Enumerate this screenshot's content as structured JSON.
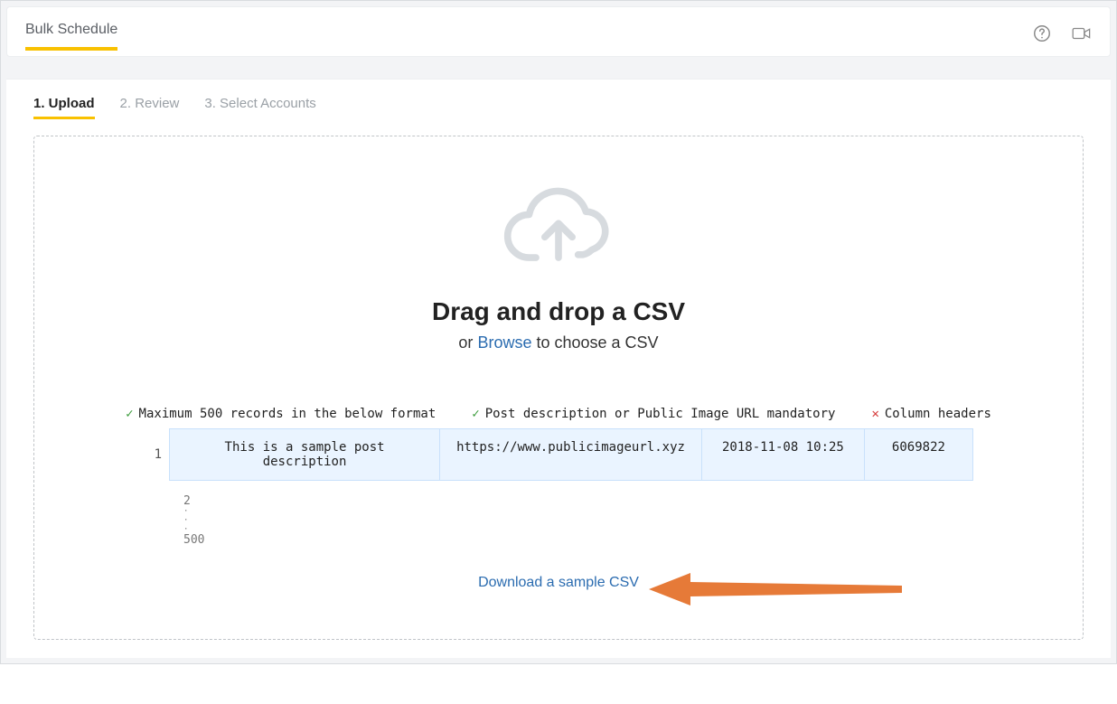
{
  "header": {
    "title": "Bulk Schedule"
  },
  "steps": [
    {
      "label": "1. Upload",
      "active": true
    },
    {
      "label": "2. Review",
      "active": false
    },
    {
      "label": "3. Select Accounts",
      "active": false
    }
  ],
  "dropzone": {
    "big_text": "Drag and drop a CSV",
    "sub_prefix": "or ",
    "browse_label": "Browse",
    "sub_suffix": " to choose a CSV"
  },
  "rules": [
    {
      "kind": "ok",
      "text": "Maximum 500 records in the below format"
    },
    {
      "kind": "ok",
      "text": "Post description or Public Image URL mandatory"
    },
    {
      "kind": "bad",
      "text": "Column headers"
    }
  ],
  "sample_row": {
    "line_no": "1",
    "cells": [
      "This is a sample post description",
      "https://www.publicimageurl.xyz",
      "2018-11-08 10:25",
      "6069822"
    ]
  },
  "more": {
    "line2": "2",
    "dots": "·\n·\n·",
    "line_last": "500"
  },
  "download_label": "Download a sample CSV"
}
